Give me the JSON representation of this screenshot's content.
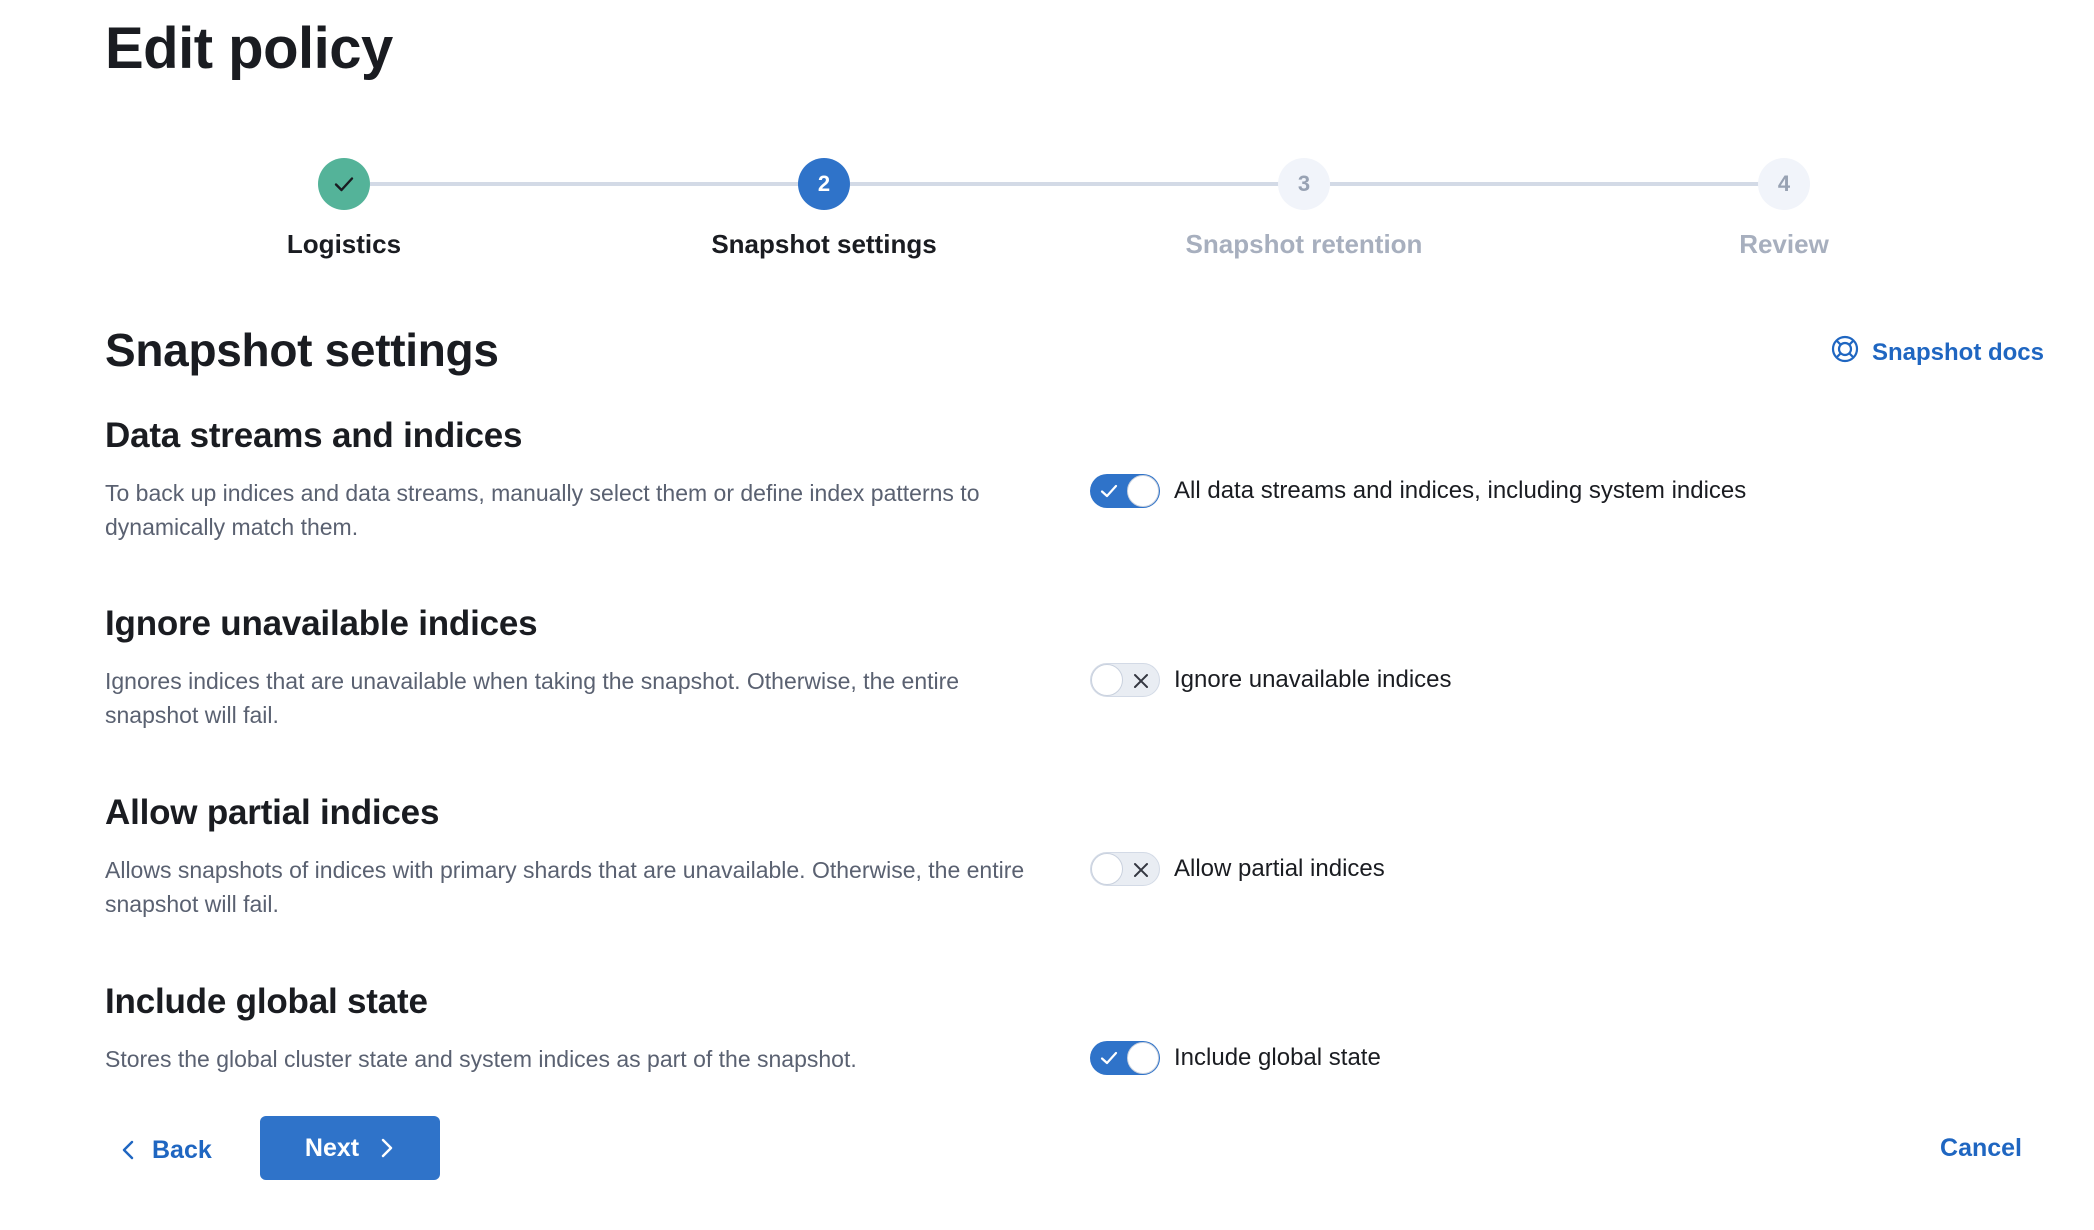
{
  "page": {
    "title": "Edit policy"
  },
  "stepper": {
    "steps": [
      {
        "number": "1",
        "title": "Logistics",
        "status": "complete"
      },
      {
        "number": "2",
        "title": "Snapshot settings",
        "status": "current"
      },
      {
        "number": "3",
        "title": "Snapshot retention",
        "status": "incomplete"
      },
      {
        "number": "4",
        "title": "Review",
        "status": "incomplete"
      }
    ]
  },
  "section": {
    "title": "Snapshot settings",
    "docs_link": {
      "label": "Snapshot docs",
      "icon": "help-lifebuoy-icon"
    }
  },
  "settings": [
    {
      "title": "Data streams and indices",
      "description": "To back up indices and data streams, manually select them or define index patterns to dynamically match them.",
      "switch_label": "All data streams and indices, including system indices",
      "checked": true
    },
    {
      "title": "Ignore unavailable indices",
      "description": "Ignores indices that are unavailable when taking the snapshot. Otherwise, the entire snapshot will fail.",
      "switch_label": "Ignore unavailable indices",
      "checked": false
    },
    {
      "title": "Allow partial indices",
      "description": "Allows snapshots of indices with primary shards that are unavailable. Otherwise, the entire snapshot will fail.",
      "switch_label": "Allow partial indices",
      "checked": false
    },
    {
      "title": "Include global state",
      "description": "Stores the global cluster state and system indices as part of the snapshot.",
      "switch_label": "Include global state",
      "checked": true
    }
  ],
  "footer": {
    "back_label": "Back",
    "next_label": "Next",
    "cancel_label": "Cancel"
  },
  "colors": {
    "primary": "#2f73c9",
    "link": "#1f66c1",
    "step_complete": "#54b399",
    "step_incomplete_text": "#a7afbe",
    "subdued_text": "#5a6171"
  }
}
